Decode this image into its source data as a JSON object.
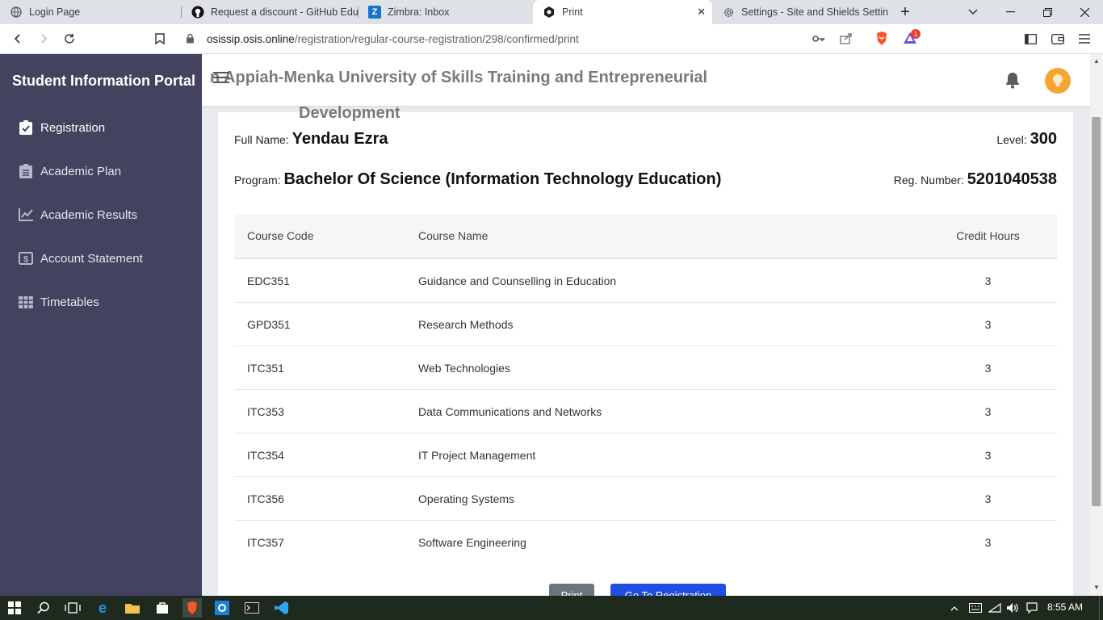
{
  "browser": {
    "tabs": [
      {
        "title": "Login Page",
        "icon": "globe-icon"
      },
      {
        "title": "Request a discount - GitHub Educa",
        "icon": "github-icon"
      },
      {
        "title": "Zimbra: Inbox",
        "icon": "zimbra-icon"
      },
      {
        "title": "Print",
        "icon": "osis-icon",
        "active": true
      },
      {
        "title": "Settings - Site and Shields Setting",
        "icon": "gear-icon"
      }
    ],
    "url_host": "osissip.osis.online",
    "url_path": "/registration/regular-course-registration/298/confirmed/print",
    "notification_count": "1"
  },
  "sidebar": {
    "brand": "Student Information Portal",
    "items": [
      {
        "label": "Registration",
        "icon": "clipboard-check-icon",
        "active": true
      },
      {
        "label": "Academic Plan",
        "icon": "clipboard-list-icon"
      },
      {
        "label": "Academic Results",
        "icon": "line-chart-icon"
      },
      {
        "label": "Account Statement",
        "icon": "dollar-bill-icon"
      },
      {
        "label": "Timetables",
        "icon": "table-grid-icon"
      }
    ]
  },
  "header": {
    "university_line1": "n Appiah-Menka University of Skills Training and Entrepreneurial",
    "university_line2": "Development"
  },
  "student": {
    "full_name_label": "Full Name:",
    "full_name": "Yendau Ezra",
    "level_label": "Level:",
    "level": "300",
    "program_label": "Program:",
    "program": "Bachelor Of Science (Information Technology Education)",
    "reg_label": "Reg. Number:",
    "reg_number": "5201040538"
  },
  "courses": {
    "headers": {
      "code": "Course Code",
      "name": "Course Name",
      "credits": "Credit Hours"
    },
    "rows": [
      {
        "code": "EDC351",
        "name": "Guidance and Counselling in Education",
        "credits": "3"
      },
      {
        "code": "GPD351",
        "name": "Research Methods",
        "credits": "3"
      },
      {
        "code": "ITC351",
        "name": "Web Technologies",
        "credits": "3"
      },
      {
        "code": "ITC353",
        "name": "Data Communications and Networks",
        "credits": "3"
      },
      {
        "code": "ITC354",
        "name": "IT Project Management",
        "credits": "3"
      },
      {
        "code": "ITC356",
        "name": "Operating Systems",
        "credits": "3"
      },
      {
        "code": "ITC357",
        "name": "Software Engineering",
        "credits": "3"
      }
    ]
  },
  "actions": {
    "print": "Print",
    "go_registration": "Go To Registration"
  },
  "taskbar": {
    "time": "8:55 AM"
  },
  "colors": {
    "sidebar_bg": "#434360",
    "primary_button": "#1f4fe0",
    "secondary_button": "#6c757d",
    "avatar": "#f6a531"
  }
}
